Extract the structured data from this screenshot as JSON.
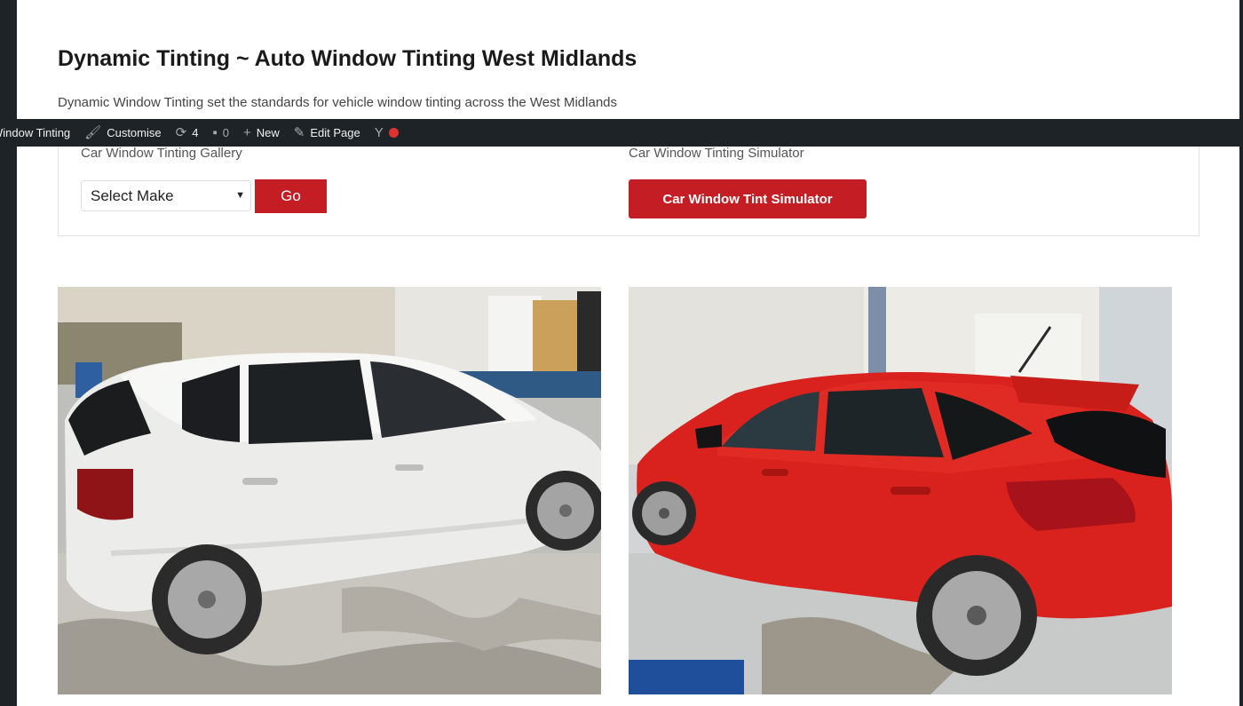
{
  "site": {
    "title": "Dynamic Tinting ~ Auto Window Tinting West Midlands",
    "description": "Dynamic Window Tinting set the standards for vehicle window tinting across the West Midlands"
  },
  "adminbar": {
    "site_name": "ic Window Tinting",
    "customise": "Customise",
    "updates_count": "4",
    "comments_count": "0",
    "new": "New",
    "edit_page": "Edit Page"
  },
  "gallery": {
    "label": "Car Window Tinting Gallery",
    "select_value": "Select Make",
    "go_label": "Go"
  },
  "simulator": {
    "label": "Car Window Tinting Simulator",
    "button_label": "Car Window Tint Simulator"
  },
  "colors": {
    "accent": "#c41e24",
    "adminbar": "#1d2327",
    "status_dot": "#dc3232"
  },
  "photos": [
    {
      "subject": "white hatchback in workshop"
    },
    {
      "subject": "red hatchback in workshop"
    }
  ]
}
